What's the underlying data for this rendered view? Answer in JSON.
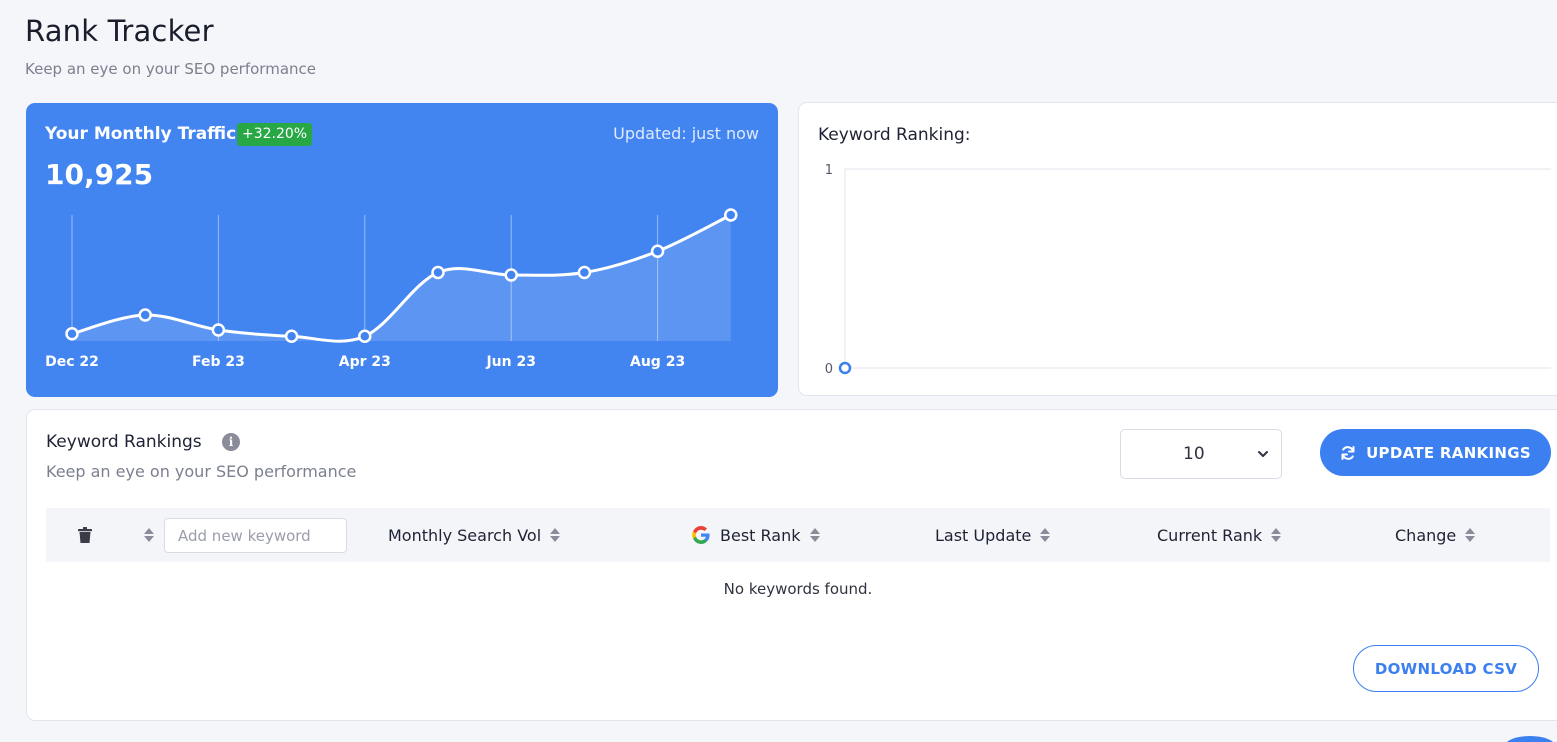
{
  "page": {
    "title": "Rank Tracker",
    "subtitle": "Keep an eye on your SEO performance"
  },
  "traffic": {
    "title": "Your Monthly Traffic",
    "change_badge": "+32.20%",
    "updated": "Updated: just now",
    "value": "10,925",
    "badge_color": "#28a745",
    "card_color": "#4285f0"
  },
  "chart_data": [
    {
      "type": "area",
      "title": "",
      "xlabel": "",
      "ylabel": "",
      "x_tick_labels": [
        "Dec 22",
        "Feb 23",
        "Apr 23",
        "Jun 23",
        "Aug 23"
      ],
      "x": [
        "Dec 22",
        "Jan 23",
        "Feb 23",
        "Mar 23",
        "Apr 23",
        "May 23",
        "Jun 23",
        "Jul 23",
        "Aug 23",
        "Sep 23"
      ],
      "values": [
        0.05,
        0.2,
        0.08,
        0.03,
        0.03,
        0.54,
        0.52,
        0.54,
        0.71,
        1.0
      ],
      "grid": "vertical lines at labeled months"
    },
    {
      "type": "line",
      "title": "Keyword Ranking:",
      "ylim": [
        0,
        1
      ],
      "y_ticks": [
        "0",
        "1"
      ],
      "x": [
        0
      ],
      "values": [
        0
      ],
      "grid": "horizontal"
    }
  ],
  "rankings": {
    "title": "Keyword Rankings",
    "info_icon": "info-icon",
    "subtitle": "Keep an eye on your SEO performance",
    "page_size": "10",
    "update_button": "UPDATE RANKINGS",
    "keyword_placeholder": "Add new keyword",
    "columns": [
      "Monthly Search Vol",
      "Best Rank",
      "Last Update",
      "Current Rank",
      "Change"
    ],
    "empty_message": "No keywords found.",
    "download_button": "DOWNLOAD CSV",
    "accent_color": "#3b7ff0"
  }
}
